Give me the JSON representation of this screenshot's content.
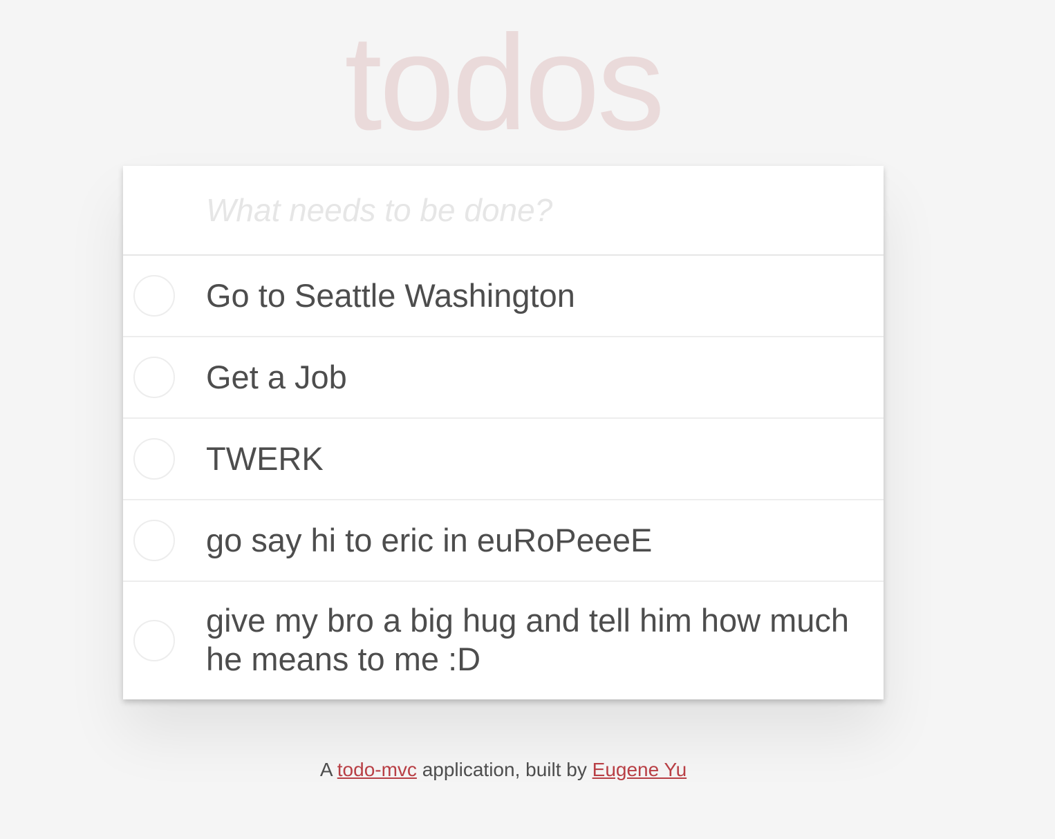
{
  "header": {
    "title": "todos"
  },
  "new_todo": {
    "placeholder": "What needs to be done?",
    "value": ""
  },
  "todos": [
    {
      "label": "Go to Seattle Washington",
      "completed": false
    },
    {
      "label": "Get a Job",
      "completed": false
    },
    {
      "label": "TWERK",
      "completed": false
    },
    {
      "label": "go say hi to eric in euRoPeeeE",
      "completed": false
    },
    {
      "label": "give my bro a big hug and tell him how much he means to me :D",
      "completed": false
    }
  ],
  "footer": {
    "prefix": "A",
    "link1_text": "todo-mvc",
    "middle": "application, built by",
    "link2_text": "Eugene Yu"
  },
  "colors": {
    "background": "#f5f5f5",
    "title": "#eadada",
    "text": "#4d4d4d",
    "link": "#b83f45",
    "border": "#ededed"
  }
}
